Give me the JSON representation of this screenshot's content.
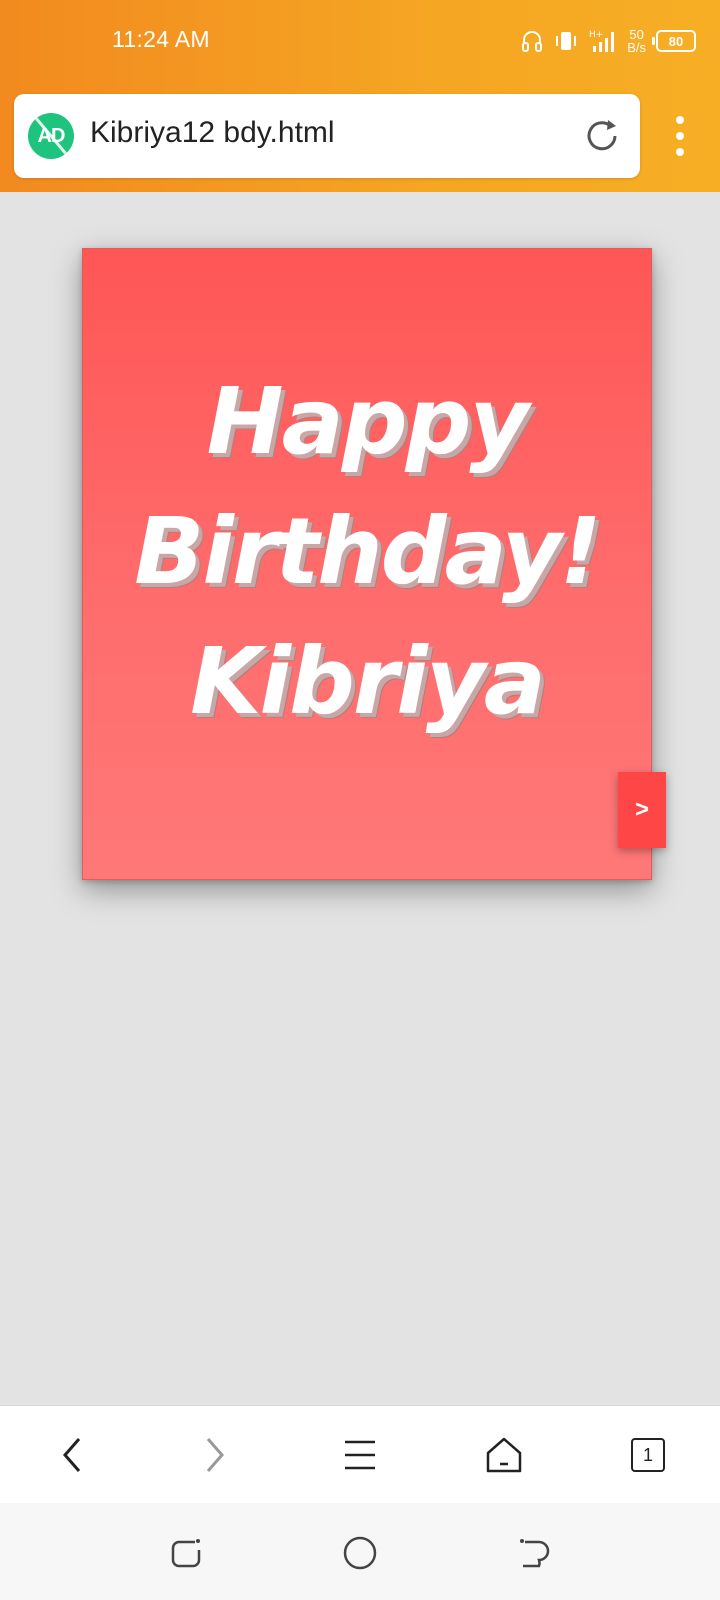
{
  "status_bar": {
    "time": "11:24 AM",
    "net_speed_value": "50",
    "net_speed_unit": "B/s",
    "battery_level": "80",
    "icons": [
      "headphones-icon",
      "vibrate-icon",
      "signal-icon",
      "battery-icon"
    ]
  },
  "address_bar": {
    "url": "Kibriya12 bdy.html",
    "adblock_badge": "AD"
  },
  "card": {
    "line1": "Happy",
    "line2": "Birthday!",
    "line3": "Kibriya",
    "next_label": ">"
  },
  "toolbar": {
    "tab_count": "1",
    "icons": [
      "back-icon",
      "forward-icon",
      "menu-lines-icon",
      "home-icon",
      "tabs-icon"
    ]
  },
  "system_nav": {
    "icons": [
      "recents-icon",
      "home-circle-icon",
      "back-arrow-icon"
    ]
  },
  "colors": {
    "header_orange": "#f5a623",
    "card_red": "#ff5656",
    "adblock_green": "#1ec47e",
    "next_button": "#ff4646"
  }
}
